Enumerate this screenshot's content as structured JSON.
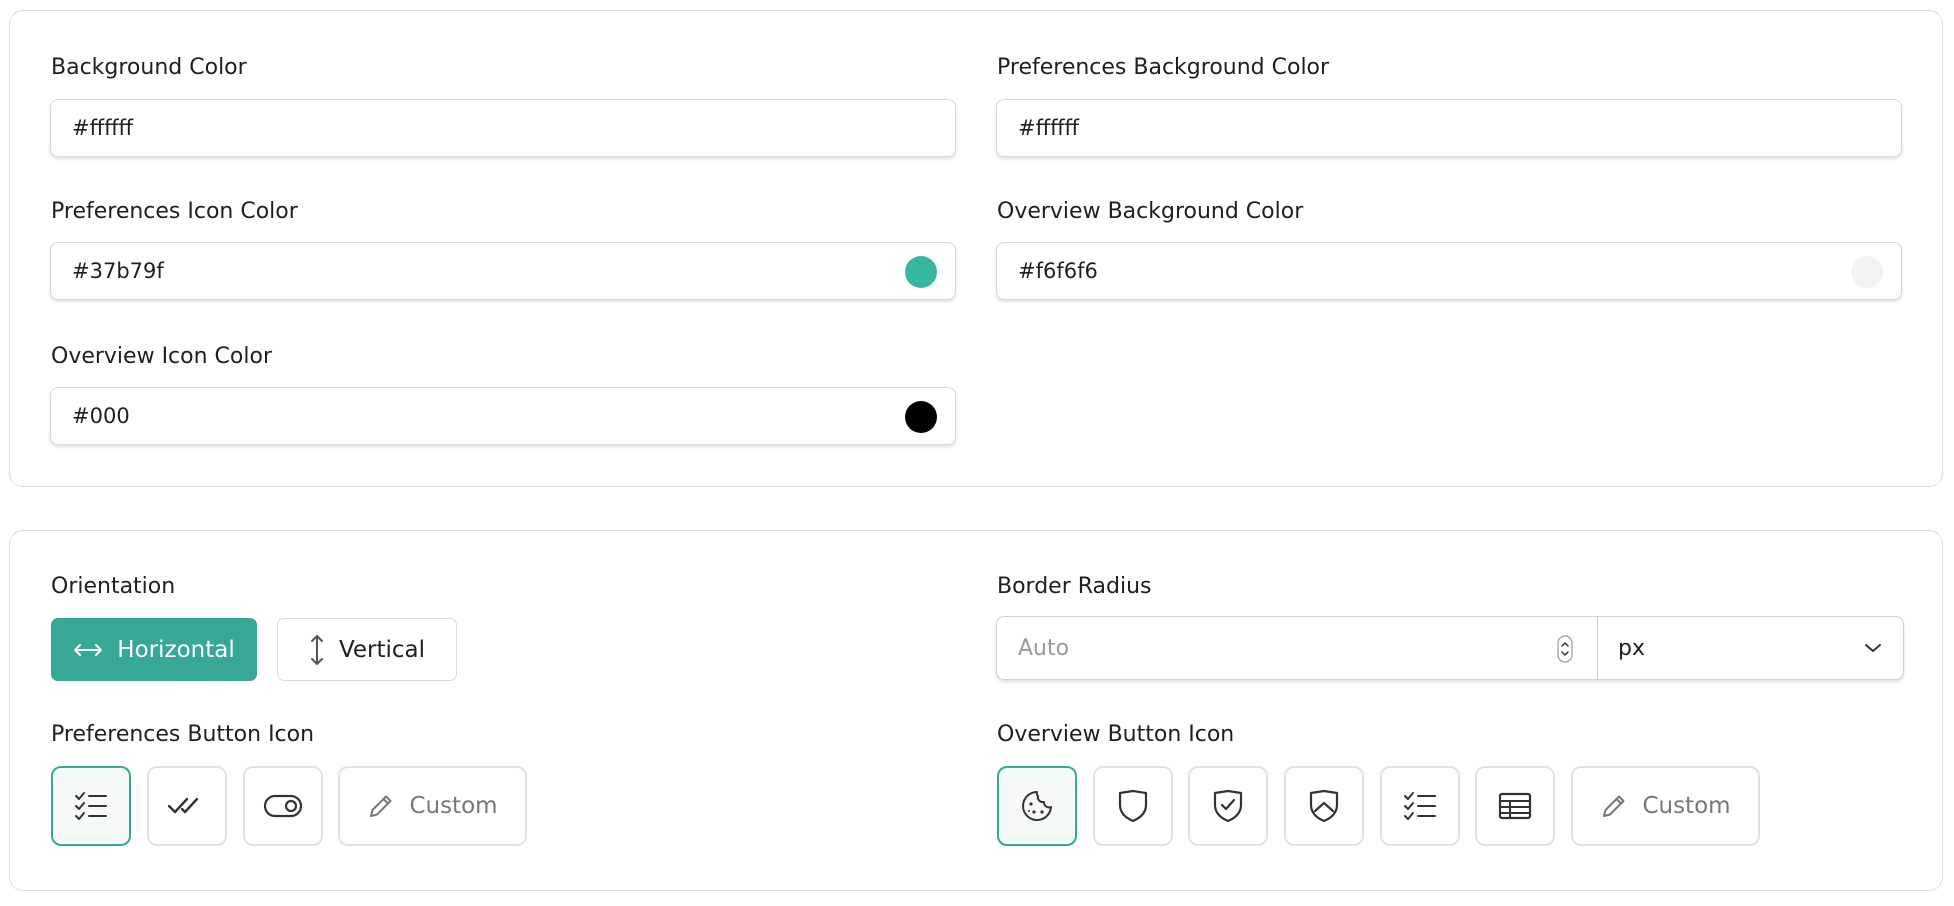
{
  "colors": {
    "background_color": {
      "label": "Background Color",
      "value": "#ffffff"
    },
    "preferences_background_color": {
      "label": "Preferences Background Color",
      "value": "#ffffff"
    },
    "preferences_icon_color": {
      "label": "Preferences Icon Color",
      "value": "#37b79f",
      "swatch": "#37b79f"
    },
    "overview_background_color": {
      "label": "Overview Background Color",
      "value": "#f6f6f6",
      "swatch": "#f6f6f6"
    },
    "overview_icon_color": {
      "label": "Overview Icon Color",
      "value": "#000",
      "swatch": "#000000"
    }
  },
  "orientation": {
    "label": "Orientation",
    "options": [
      {
        "label": "Horizontal",
        "icon": "arrows-horizontal-icon",
        "active": true
      },
      {
        "label": "Vertical",
        "icon": "arrows-vertical-icon",
        "active": false
      }
    ]
  },
  "border_radius": {
    "label": "Border Radius",
    "placeholder": "Auto",
    "unit": "px"
  },
  "preferences_button_icon": {
    "label": "Preferences Button Icon",
    "options": [
      "list-check-icon",
      "double-check-icon",
      "toggle-icon",
      "custom"
    ],
    "selected": "list-check-icon",
    "custom_label": "Custom"
  },
  "overview_button_icon": {
    "label": "Overview Button Icon",
    "options": [
      "cookie-icon",
      "shield-icon",
      "shield-check-icon",
      "shield-half-icon",
      "list-check-icon",
      "table-icon",
      "custom"
    ],
    "selected": "cookie-icon",
    "custom_label": "Custom"
  },
  "theme": {
    "accent": "#37a893"
  }
}
